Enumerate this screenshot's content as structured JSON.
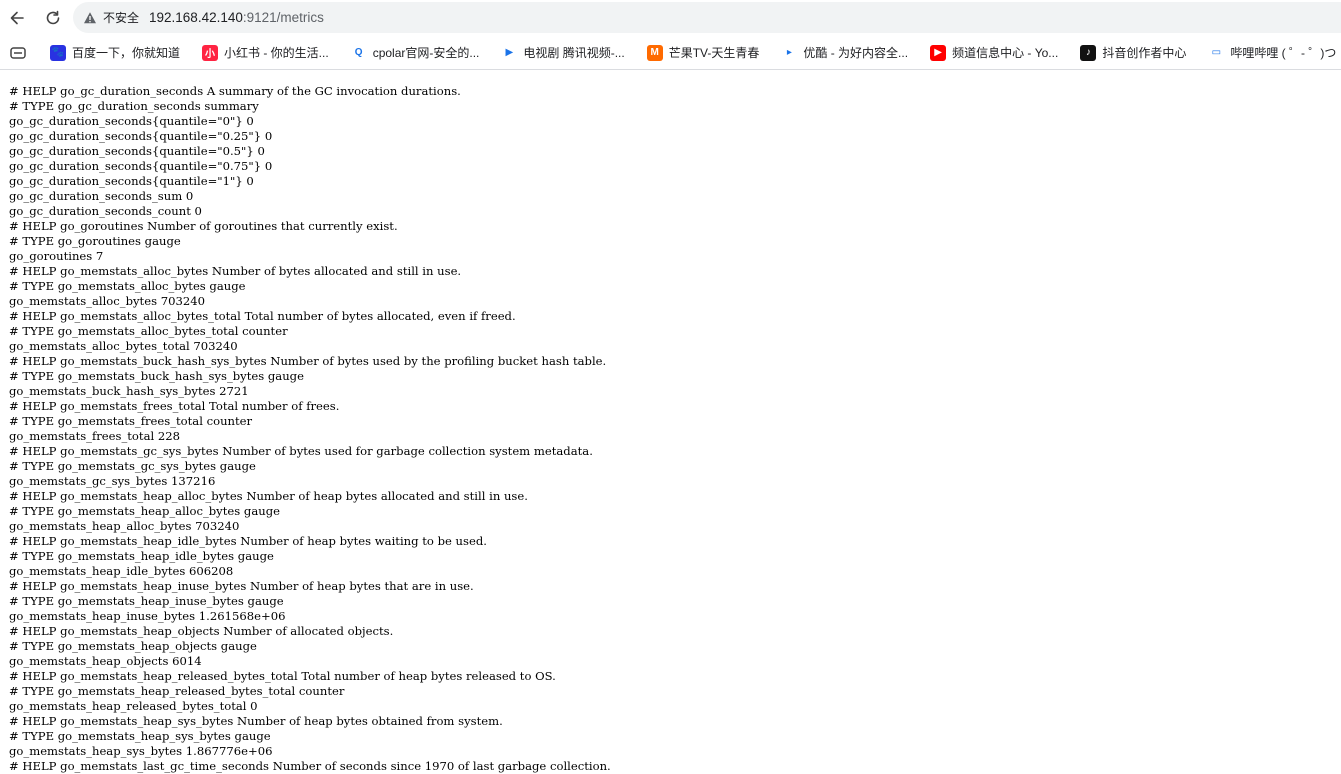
{
  "browser": {
    "security_label": "不安全",
    "url_host": "192.168.42.140",
    "url_rest": ":9121/metrics",
    "back_icon": "back-arrow-icon",
    "reload_icon": "reload-icon",
    "warning_icon": "warning-triangle-icon"
  },
  "bookmarks": {
    "items": [
      {
        "label": "百度一下，你就知道",
        "icon": "baidu-icon",
        "color": "#2932e1",
        "glyph": "🐾"
      },
      {
        "label": "小红书 - 你的生活...",
        "icon": "xiaohongshu-icon",
        "color": "#ff2442",
        "glyph": "小"
      },
      {
        "label": "cpolar官网-安全的...",
        "icon": "cpolar-icon",
        "color": "#ffffff",
        "glyph": "Q"
      },
      {
        "label": "电视剧 腾讯视频-...",
        "icon": "tencent-video-icon",
        "color": "#ffffff",
        "glyph": "▶"
      },
      {
        "label": "芒果TV-天生青春",
        "icon": "mangotv-icon",
        "color": "#ff6a00",
        "glyph": "M"
      },
      {
        "label": "优酷 - 为好内容全...",
        "icon": "youku-icon",
        "color": "#ffffff",
        "glyph": "▸"
      },
      {
        "label": "频道信息中心 - Yo...",
        "icon": "youtube-icon",
        "color": "#ff0000",
        "glyph": "▶"
      },
      {
        "label": "抖音创作者中心",
        "icon": "douyin-icon",
        "color": "#111111",
        "glyph": "♪"
      },
      {
        "label": "哔哩哔哩 ( ゜- ゜)つ",
        "icon": "bilibili-icon",
        "color": "#ffffff",
        "glyph": "▭"
      }
    ]
  },
  "metrics": {
    "lines": [
      "# HELP go_gc_duration_seconds A summary of the GC invocation durations.",
      "# TYPE go_gc_duration_seconds summary",
      "go_gc_duration_seconds{quantile=\"0\"} 0",
      "go_gc_duration_seconds{quantile=\"0.25\"} 0",
      "go_gc_duration_seconds{quantile=\"0.5\"} 0",
      "go_gc_duration_seconds{quantile=\"0.75\"} 0",
      "go_gc_duration_seconds{quantile=\"1\"} 0",
      "go_gc_duration_seconds_sum 0",
      "go_gc_duration_seconds_count 0",
      "# HELP go_goroutines Number of goroutines that currently exist.",
      "# TYPE go_goroutines gauge",
      "go_goroutines 7",
      "# HELP go_memstats_alloc_bytes Number of bytes allocated and still in use.",
      "# TYPE go_memstats_alloc_bytes gauge",
      "go_memstats_alloc_bytes 703240",
      "# HELP go_memstats_alloc_bytes_total Total number of bytes allocated, even if freed.",
      "# TYPE go_memstats_alloc_bytes_total counter",
      "go_memstats_alloc_bytes_total 703240",
      "# HELP go_memstats_buck_hash_sys_bytes Number of bytes used by the profiling bucket hash table.",
      "# TYPE go_memstats_buck_hash_sys_bytes gauge",
      "go_memstats_buck_hash_sys_bytes 2721",
      "# HELP go_memstats_frees_total Total number of frees.",
      "# TYPE go_memstats_frees_total counter",
      "go_memstats_frees_total 228",
      "# HELP go_memstats_gc_sys_bytes Number of bytes used for garbage collection system metadata.",
      "# TYPE go_memstats_gc_sys_bytes gauge",
      "go_memstats_gc_sys_bytes 137216",
      "# HELP go_memstats_heap_alloc_bytes Number of heap bytes allocated and still in use.",
      "# TYPE go_memstats_heap_alloc_bytes gauge",
      "go_memstats_heap_alloc_bytes 703240",
      "# HELP go_memstats_heap_idle_bytes Number of heap bytes waiting to be used.",
      "# TYPE go_memstats_heap_idle_bytes gauge",
      "go_memstats_heap_idle_bytes 606208",
      "# HELP go_memstats_heap_inuse_bytes Number of heap bytes that are in use.",
      "# TYPE go_memstats_heap_inuse_bytes gauge",
      "go_memstats_heap_inuse_bytes 1.261568e+06",
      "# HELP go_memstats_heap_objects Number of allocated objects.",
      "# TYPE go_memstats_heap_objects gauge",
      "go_memstats_heap_objects 6014",
      "# HELP go_memstats_heap_released_bytes_total Total number of heap bytes released to OS.",
      "# TYPE go_memstats_heap_released_bytes_total counter",
      "go_memstats_heap_released_bytes_total 0",
      "# HELP go_memstats_heap_sys_bytes Number of heap bytes obtained from system.",
      "# TYPE go_memstats_heap_sys_bytes gauge",
      "go_memstats_heap_sys_bytes 1.867776e+06",
      "# HELP go_memstats_last_gc_time_seconds Number of seconds since 1970 of last garbage collection."
    ]
  }
}
